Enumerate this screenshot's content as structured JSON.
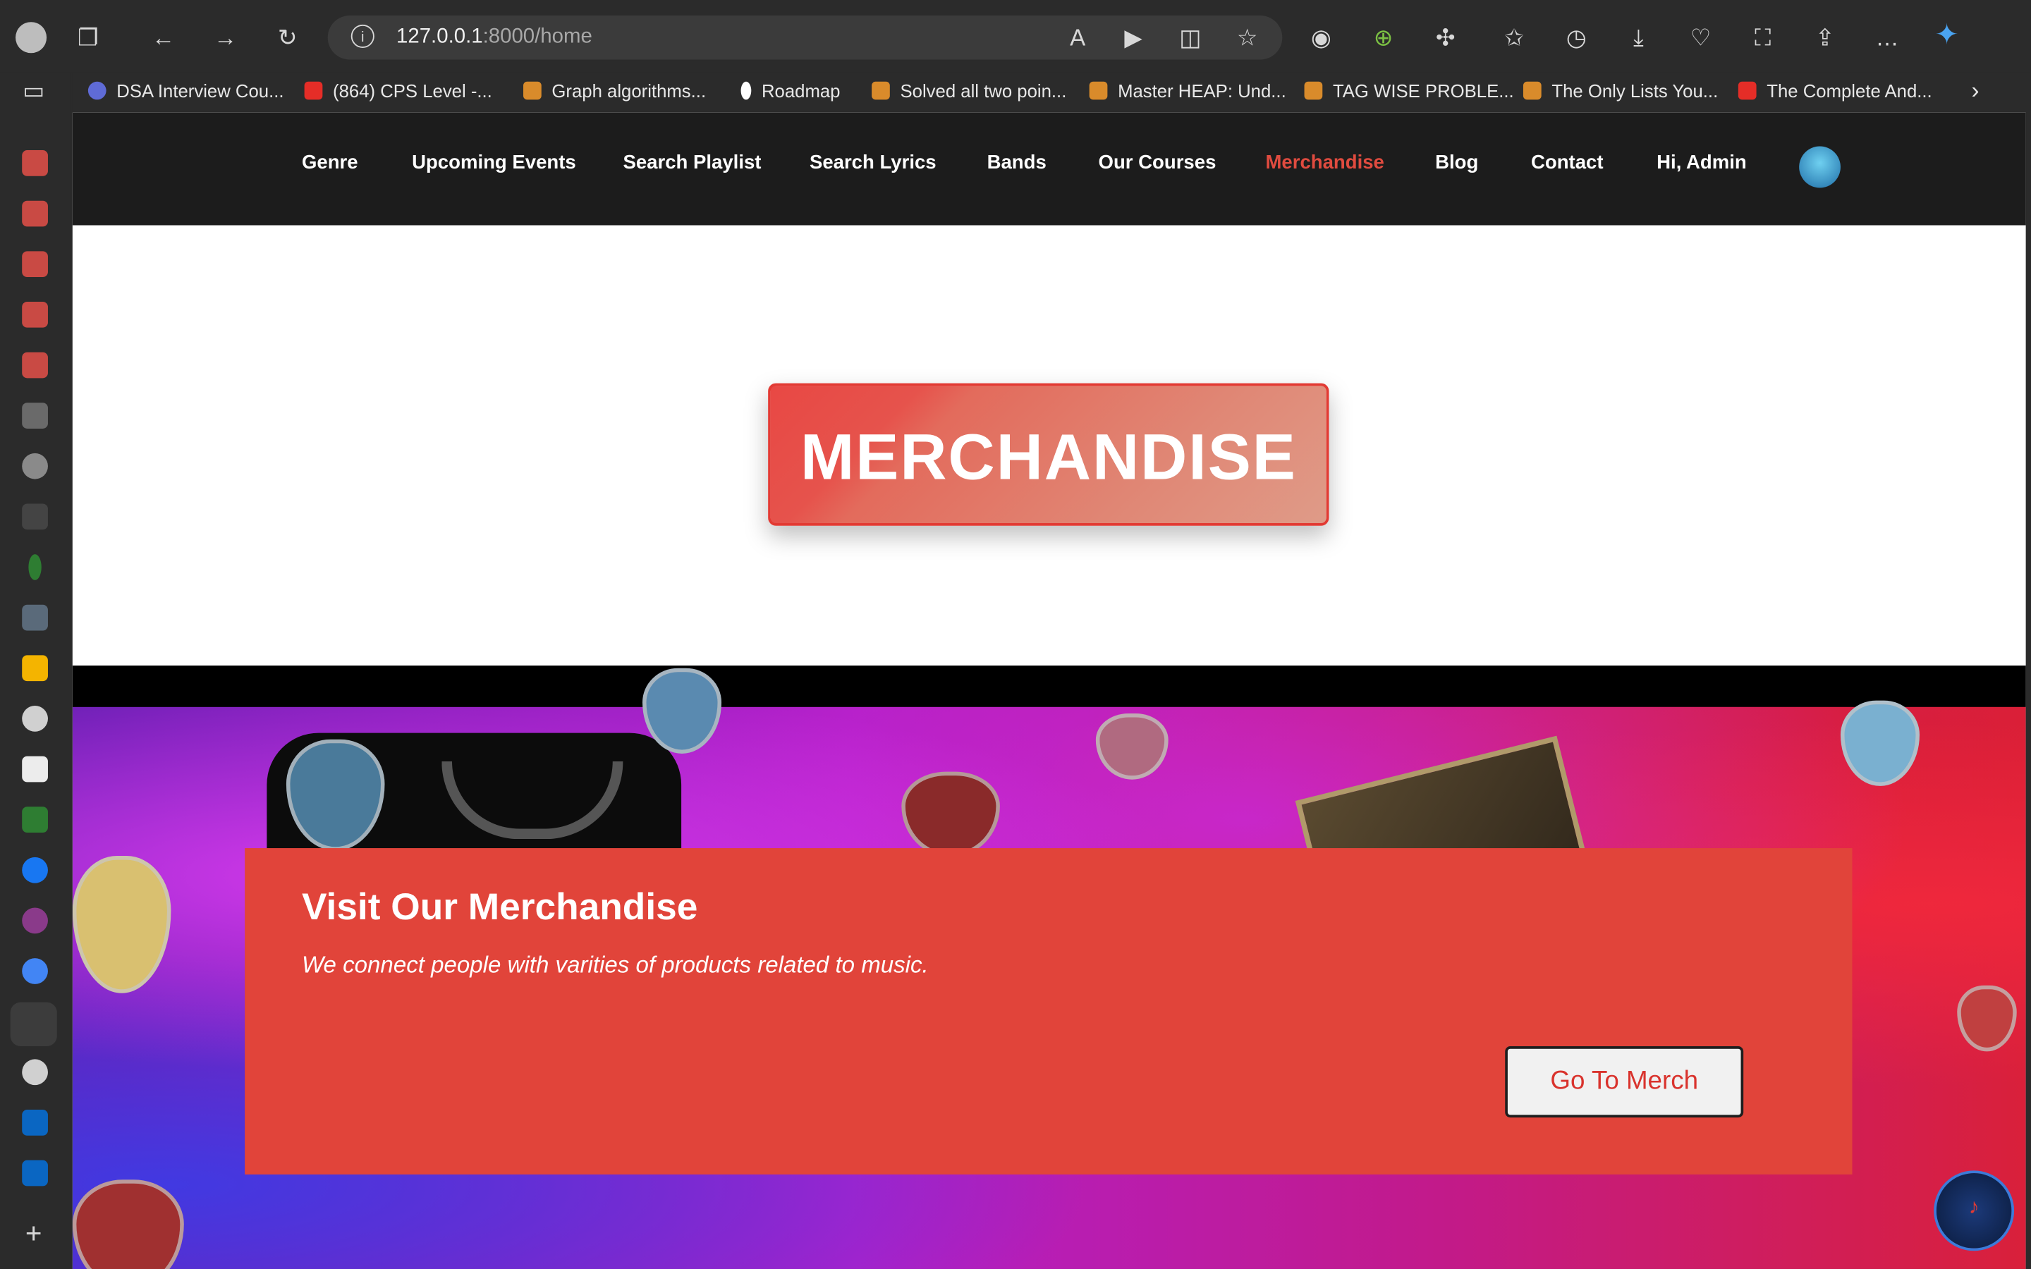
{
  "browser": {
    "url_host": "127.0.0.1",
    "url_path": ":8000/home",
    "bookmarks": [
      {
        "label": "DSA Interview Cou...",
        "color": "#5f6bd6"
      },
      {
        "label": "(864) CPS Level -...",
        "color": "#e52d27"
      },
      {
        "label": "Graph algorithms...",
        "color": "#d98b2b"
      },
      {
        "label": "Roadmap",
        "color": "#ffffff"
      },
      {
        "label": "Solved all two poin...",
        "color": "#d98b2b"
      },
      {
        "label": "Master HEAP: Und...",
        "color": "#d98b2b"
      },
      {
        "label": "TAG WISE PROBLE...",
        "color": "#d98b2b"
      },
      {
        "label": "The Only Lists You...",
        "color": "#d98b2b"
      },
      {
        "label": "The Complete And...",
        "color": "#e52d27"
      }
    ]
  },
  "nav": {
    "items": [
      {
        "label": "Genre"
      },
      {
        "label": "Upcoming Events"
      },
      {
        "label": "Search Playlist"
      },
      {
        "label": "Search Lyrics"
      },
      {
        "label": "Bands"
      },
      {
        "label": "Our Courses"
      },
      {
        "label": "Merchandise",
        "active": true
      },
      {
        "label": "Blog"
      },
      {
        "label": "Contact"
      },
      {
        "label": "Hi, Admin"
      }
    ],
    "active_color": "#e04b3f"
  },
  "hero": {
    "title": "MERCHANDISE"
  },
  "banner": {
    "heading": "Visit Our Merchandise",
    "subtitle": "We connect people with varities of products related to music.",
    "button_label": "Go To Merch",
    "panel_color": "#e1443a"
  },
  "logo_symbol": "♪"
}
